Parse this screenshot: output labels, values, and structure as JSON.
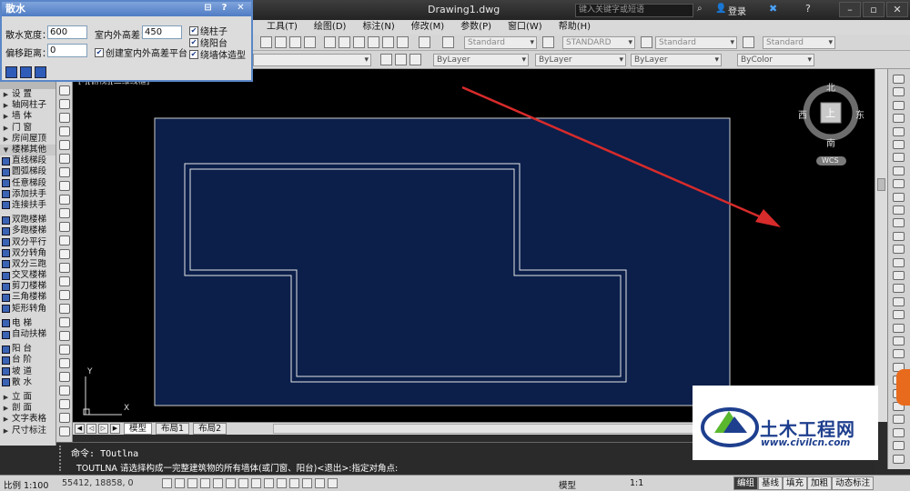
{
  "titlebar": {
    "menus": [
      "工具(T)",
      "绘图(D)",
      "标注(N)",
      "修改(M)",
      "参数(P)",
      "窗口(W)",
      "帮助(H)"
    ],
    "document_title": "Drawing1.dwg",
    "search_placeholder": "键入关键字或短语",
    "login": "登录"
  },
  "toolbar": {
    "text_style": "Standard",
    "dim_style": "STANDARD",
    "table_style": "Standard",
    "multileader_style": "Standard",
    "layer_color": "ByLayer",
    "linetype": "ByLayer",
    "lineweight": "ByLayer",
    "plot_style": "ByColor"
  },
  "panel": {
    "title": "散水",
    "width_label": "散水宽度：",
    "width_value": "600",
    "height_diff_label": "室内外高差：",
    "height_diff_value": "450",
    "offset_label": "偏移距离：",
    "offset_value": "0",
    "platform_label": "创建室内外高差平台",
    "opt_column": "绕柱子",
    "opt_balcony": "绕阳台",
    "opt_wall": "绕墙体造型"
  },
  "sidebar": {
    "items": [
      {
        "label": "设  置",
        "type": "group"
      },
      {
        "label": "轴网柱子",
        "type": "group"
      },
      {
        "label": "墙  体",
        "type": "group"
      },
      {
        "label": "门  窗",
        "type": "group"
      },
      {
        "label": "房间屋顶",
        "type": "group"
      },
      {
        "label": "楼梯其他",
        "type": "open"
      },
      {
        "label": "直线梯段",
        "type": "tool"
      },
      {
        "label": "圆弧梯段",
        "type": "tool"
      },
      {
        "label": "任意梯段",
        "type": "tool"
      },
      {
        "label": "添加扶手",
        "type": "tool"
      },
      {
        "label": "连接扶手",
        "type": "tool"
      },
      {
        "label": "",
        "type": "sep"
      },
      {
        "label": "双跑楼梯",
        "type": "tool"
      },
      {
        "label": "多跑楼梯",
        "type": "tool"
      },
      {
        "label": "双分平行",
        "type": "tool"
      },
      {
        "label": "双分转角",
        "type": "tool"
      },
      {
        "label": "双分三跑",
        "type": "tool"
      },
      {
        "label": "交叉楼梯",
        "type": "tool"
      },
      {
        "label": "剪刀楼梯",
        "type": "tool"
      },
      {
        "label": "三角楼梯",
        "type": "tool"
      },
      {
        "label": "矩形转角",
        "type": "tool"
      },
      {
        "label": "",
        "type": "sep"
      },
      {
        "label": "电  梯",
        "type": "tool"
      },
      {
        "label": "自动扶梯",
        "type": "tool"
      },
      {
        "label": "",
        "type": "sep"
      },
      {
        "label": "阳  台",
        "type": "tool"
      },
      {
        "label": "台  阶",
        "type": "tool"
      },
      {
        "label": "坡  道",
        "type": "tool"
      },
      {
        "label": "散  水",
        "type": "tool"
      },
      {
        "label": "",
        "type": "sep"
      },
      {
        "label": "立  面",
        "type": "group"
      },
      {
        "label": "剖  面",
        "type": "group"
      },
      {
        "label": "文字表格",
        "type": "group"
      },
      {
        "label": "尺寸标注",
        "type": "group"
      }
    ]
  },
  "viewcube": {
    "north": "北",
    "south": "南",
    "east": "东",
    "west": "西",
    "top": "上",
    "wcs": "WCS"
  },
  "viewport_label": "[-][俯视][二维线框]",
  "ucs": {
    "x": "X",
    "y": "Y"
  },
  "tabs": [
    "模型",
    "布局1",
    "布局2"
  ],
  "command": {
    "prompt": "命令:",
    "last_command": "TOutlna",
    "current": "TOUTLNA 请选择构成一完整建筑物的所有墙体(或门窗、阳台)<退出>:指定对角点:"
  },
  "status": {
    "scale": "比例 1:100",
    "coords": "55412, 18858, 0",
    "model": "模型",
    "zoom": "1:1",
    "buttons": [
      "编组",
      "基线",
      "填充",
      "加粗",
      "动态标注"
    ]
  },
  "watermark": {
    "title": "土木工程网",
    "url": "www.civilcn.com"
  },
  "colors": {
    "canvas_bg": "#000000",
    "inner_rect": "#0b1f4a",
    "arrow": "#d82b2b",
    "wall_lines": "#e6e6e6"
  }
}
